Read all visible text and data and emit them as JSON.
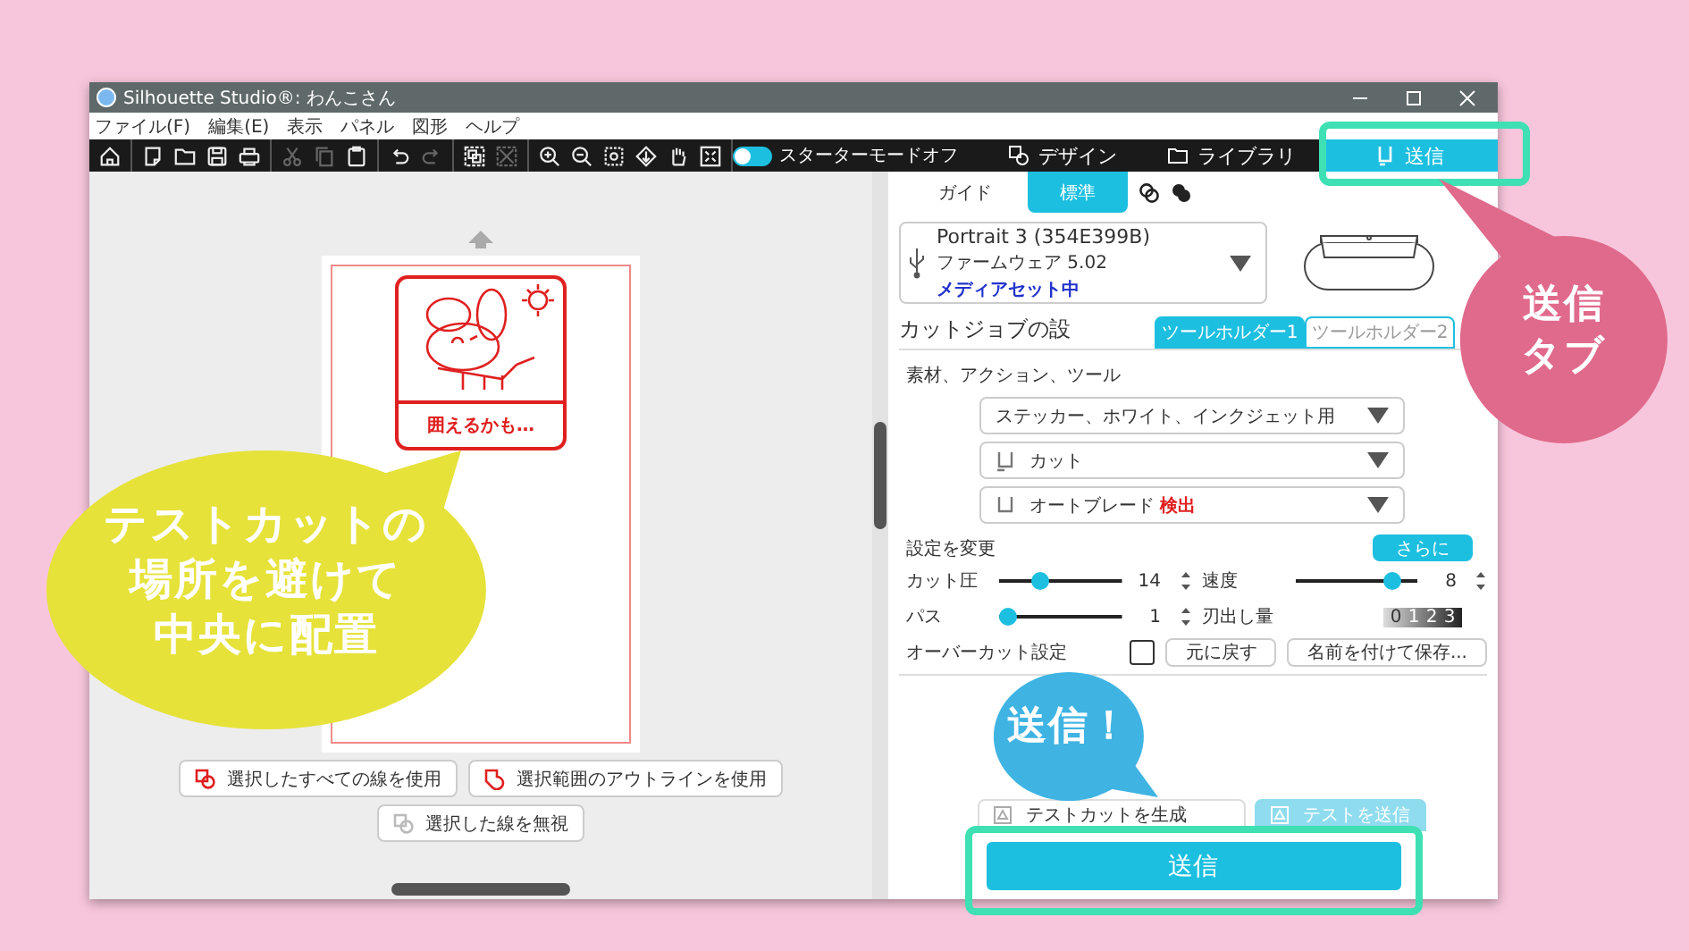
{
  "window": {
    "title": "Silhouette Studio®: わんこさん"
  },
  "menu": [
    "ファイル(F)",
    "編集(E)",
    "表示",
    "パネル",
    "図形",
    "ヘルプ"
  ],
  "toolbar_groups": [
    {
      "tools": [
        {
          "kind": "home",
          "disabled": false
        }
      ]
    },
    {
      "tools": [
        {
          "kind": "new",
          "disabled": false
        },
        {
          "kind": "open",
          "disabled": false
        },
        {
          "kind": "save",
          "disabled": false
        },
        {
          "kind": "print",
          "disabled": false
        }
      ]
    },
    {
      "tools": [
        {
          "kind": "cut",
          "disabled": true
        },
        {
          "kind": "copy",
          "disabled": true
        },
        {
          "kind": "paste",
          "disabled": false
        }
      ]
    },
    {
      "tools": [
        {
          "kind": "undo",
          "disabled": false
        },
        {
          "kind": "redo",
          "disabled": true
        }
      ]
    },
    {
      "tools": [
        {
          "kind": "group",
          "disabled": false
        },
        {
          "kind": "ungroup",
          "disabled": true
        }
      ]
    },
    {
      "tools": [
        {
          "kind": "zoom-in",
          "disabled": false
        },
        {
          "kind": "zoom-out",
          "disabled": false
        },
        {
          "kind": "zoom-box",
          "disabled": false
        },
        {
          "kind": "move-down",
          "disabled": false
        },
        {
          "kind": "hand",
          "disabled": false
        },
        {
          "kind": "fit",
          "disabled": false
        }
      ]
    }
  ],
  "starter_mode": {
    "label": "スターターモードオフ",
    "on": false
  },
  "tabs": [
    {
      "label": "デザイン",
      "kind": "design",
      "selected": false
    },
    {
      "label": "ライブラリ",
      "kind": "library",
      "selected": false
    },
    {
      "label": "送信",
      "kind": "send",
      "selected": true
    }
  ],
  "canvas": {
    "sticker_text": "囲えるかも…",
    "buttons": [
      {
        "label": "選択したすべての線を使用",
        "kind": "all-lines"
      },
      {
        "label": "選択範囲のアウトラインを使用",
        "kind": "outline"
      },
      {
        "label": "選択した線を無視",
        "kind": "ignore"
      }
    ]
  },
  "send_panel": {
    "mode_tabs": [
      {
        "label": "ガイド",
        "selected": false
      },
      {
        "label": "標準",
        "selected": true
      }
    ],
    "device": {
      "name": "Portrait 3 (354E399B)",
      "firmware": "ファームウェア 5.02",
      "status": "メディアセット中"
    },
    "section_title": "カットジョブの設",
    "tool_holders": [
      {
        "label": "ツールホルダー1",
        "selected": true
      },
      {
        "label": "ツールホルダー2",
        "selected": false
      }
    ],
    "material_heading": "素材、アクション、ツール",
    "dropdowns": [
      {
        "kind": "material",
        "value": "ステッカー、ホワイト、インクジェット用"
      },
      {
        "kind": "action",
        "value": "カット"
      },
      {
        "kind": "tool",
        "value": "オートブレード",
        "note": "検出"
      }
    ],
    "settings_heading": "設定を変更",
    "more_button": "さらに",
    "settings": [
      {
        "kind": "slider",
        "label": "カット圧",
        "level": 0.3,
        "reading": "14"
      },
      {
        "kind": "slider",
        "label": "速度",
        "level": 0.85,
        "reading": "8"
      },
      {
        "kind": "slider",
        "label": "パス",
        "level": 0,
        "reading": "1"
      },
      {
        "kind": "dial",
        "label": "刃出し量",
        "digits": [
          "0",
          "1",
          "2",
          "3"
        ]
      }
    ],
    "overcut": {
      "label": "オーバーカット設定",
      "checked": false
    },
    "reset_button": "元に戻す",
    "save_button": "名前を付けて保存...",
    "test_buttons": [
      {
        "label": "テストカットを生成",
        "kind": "outline"
      },
      {
        "label": "テストを送信",
        "kind": "filled"
      }
    ],
    "send_button": "送信"
  },
  "callouts": [
    {
      "kind": "tab-note",
      "color": "#e06a8c",
      "lines": [
        "送信",
        "タブ"
      ]
    },
    {
      "kind": "placement-note",
      "color": "#e6e23a",
      "lines": [
        "テストカットの",
        "場所を避けて",
        "中央に配置"
      ]
    },
    {
      "kind": "send-note",
      "color": "#3fb4e3",
      "lines": [
        "送信！"
      ]
    }
  ]
}
